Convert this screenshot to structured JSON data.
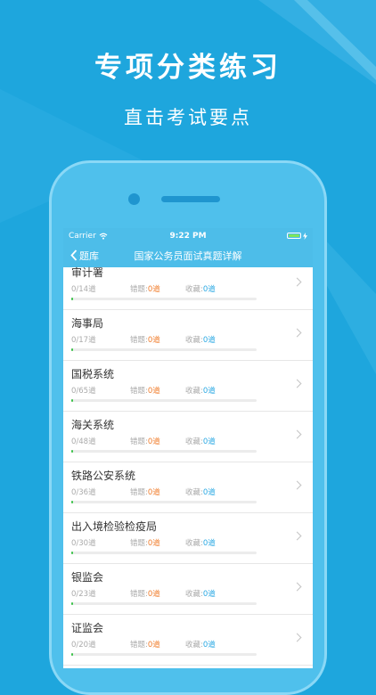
{
  "promo": {
    "title": "专项分类练习",
    "subtitle": "直击考试要点"
  },
  "status_bar": {
    "carrier": "Carrier",
    "time": "9:22 PM",
    "battery_level": 1.0
  },
  "nav": {
    "back_label": "题库",
    "title": "国家公务员面试真题详解"
  },
  "labels": {
    "wrong": "错题:",
    "fav": "收藏:"
  },
  "items": [
    {
      "name": "审计署",
      "total": "0/14道",
      "wrong": "0道",
      "fav": "0道",
      "progress": 0
    },
    {
      "name": "海事局",
      "total": "0/17道",
      "wrong": "0道",
      "fav": "0道",
      "progress": 0
    },
    {
      "name": "国税系统",
      "total": "0/65道",
      "wrong": "0道",
      "fav": "0道",
      "progress": 0
    },
    {
      "name": "海关系统",
      "total": "0/48道",
      "wrong": "0道",
      "fav": "0道",
      "progress": 0
    },
    {
      "name": "铁路公安系统",
      "total": "0/36道",
      "wrong": "0道",
      "fav": "0道",
      "progress": 0
    },
    {
      "name": "出入境检验检疫局",
      "total": "0/30道",
      "wrong": "0道",
      "fav": "0道",
      "progress": 0
    },
    {
      "name": "银监会",
      "total": "0/23道",
      "wrong": "0道",
      "fav": "0道",
      "progress": 0
    },
    {
      "name": "证监会",
      "total": "0/20道",
      "wrong": "0道",
      "fav": "0道",
      "progress": 0
    }
  ],
  "colors": {
    "background": "#1ea6dd",
    "nav": "#4dbde9",
    "wrong_accent": "#f07c2b",
    "fav_accent": "#2aa8e3",
    "progress": "#3cc24a"
  }
}
